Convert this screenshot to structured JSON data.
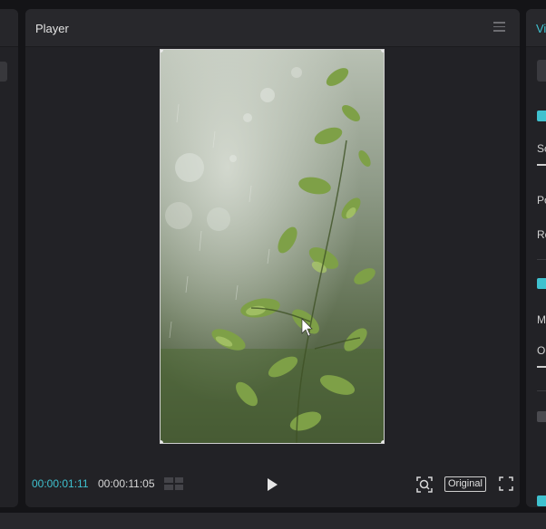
{
  "player": {
    "title": "Player",
    "current_time": "00:00:01:11",
    "total_time": "00:00:11:05",
    "ratio_button": "Original",
    "icons": {
      "menu": "menu-icon",
      "timeline_grid": "grid-icon",
      "play": "play-icon",
      "scan": "scan-icon",
      "fullscreen": "fullscreen-icon"
    }
  },
  "right_panel": {
    "title": "Vi",
    "labels": [
      "Sc",
      "Po",
      "Ro",
      "M",
      "O"
    ]
  },
  "colors": {
    "accent": "#3fc1cf",
    "panel": "#222226",
    "background": "#141417"
  }
}
